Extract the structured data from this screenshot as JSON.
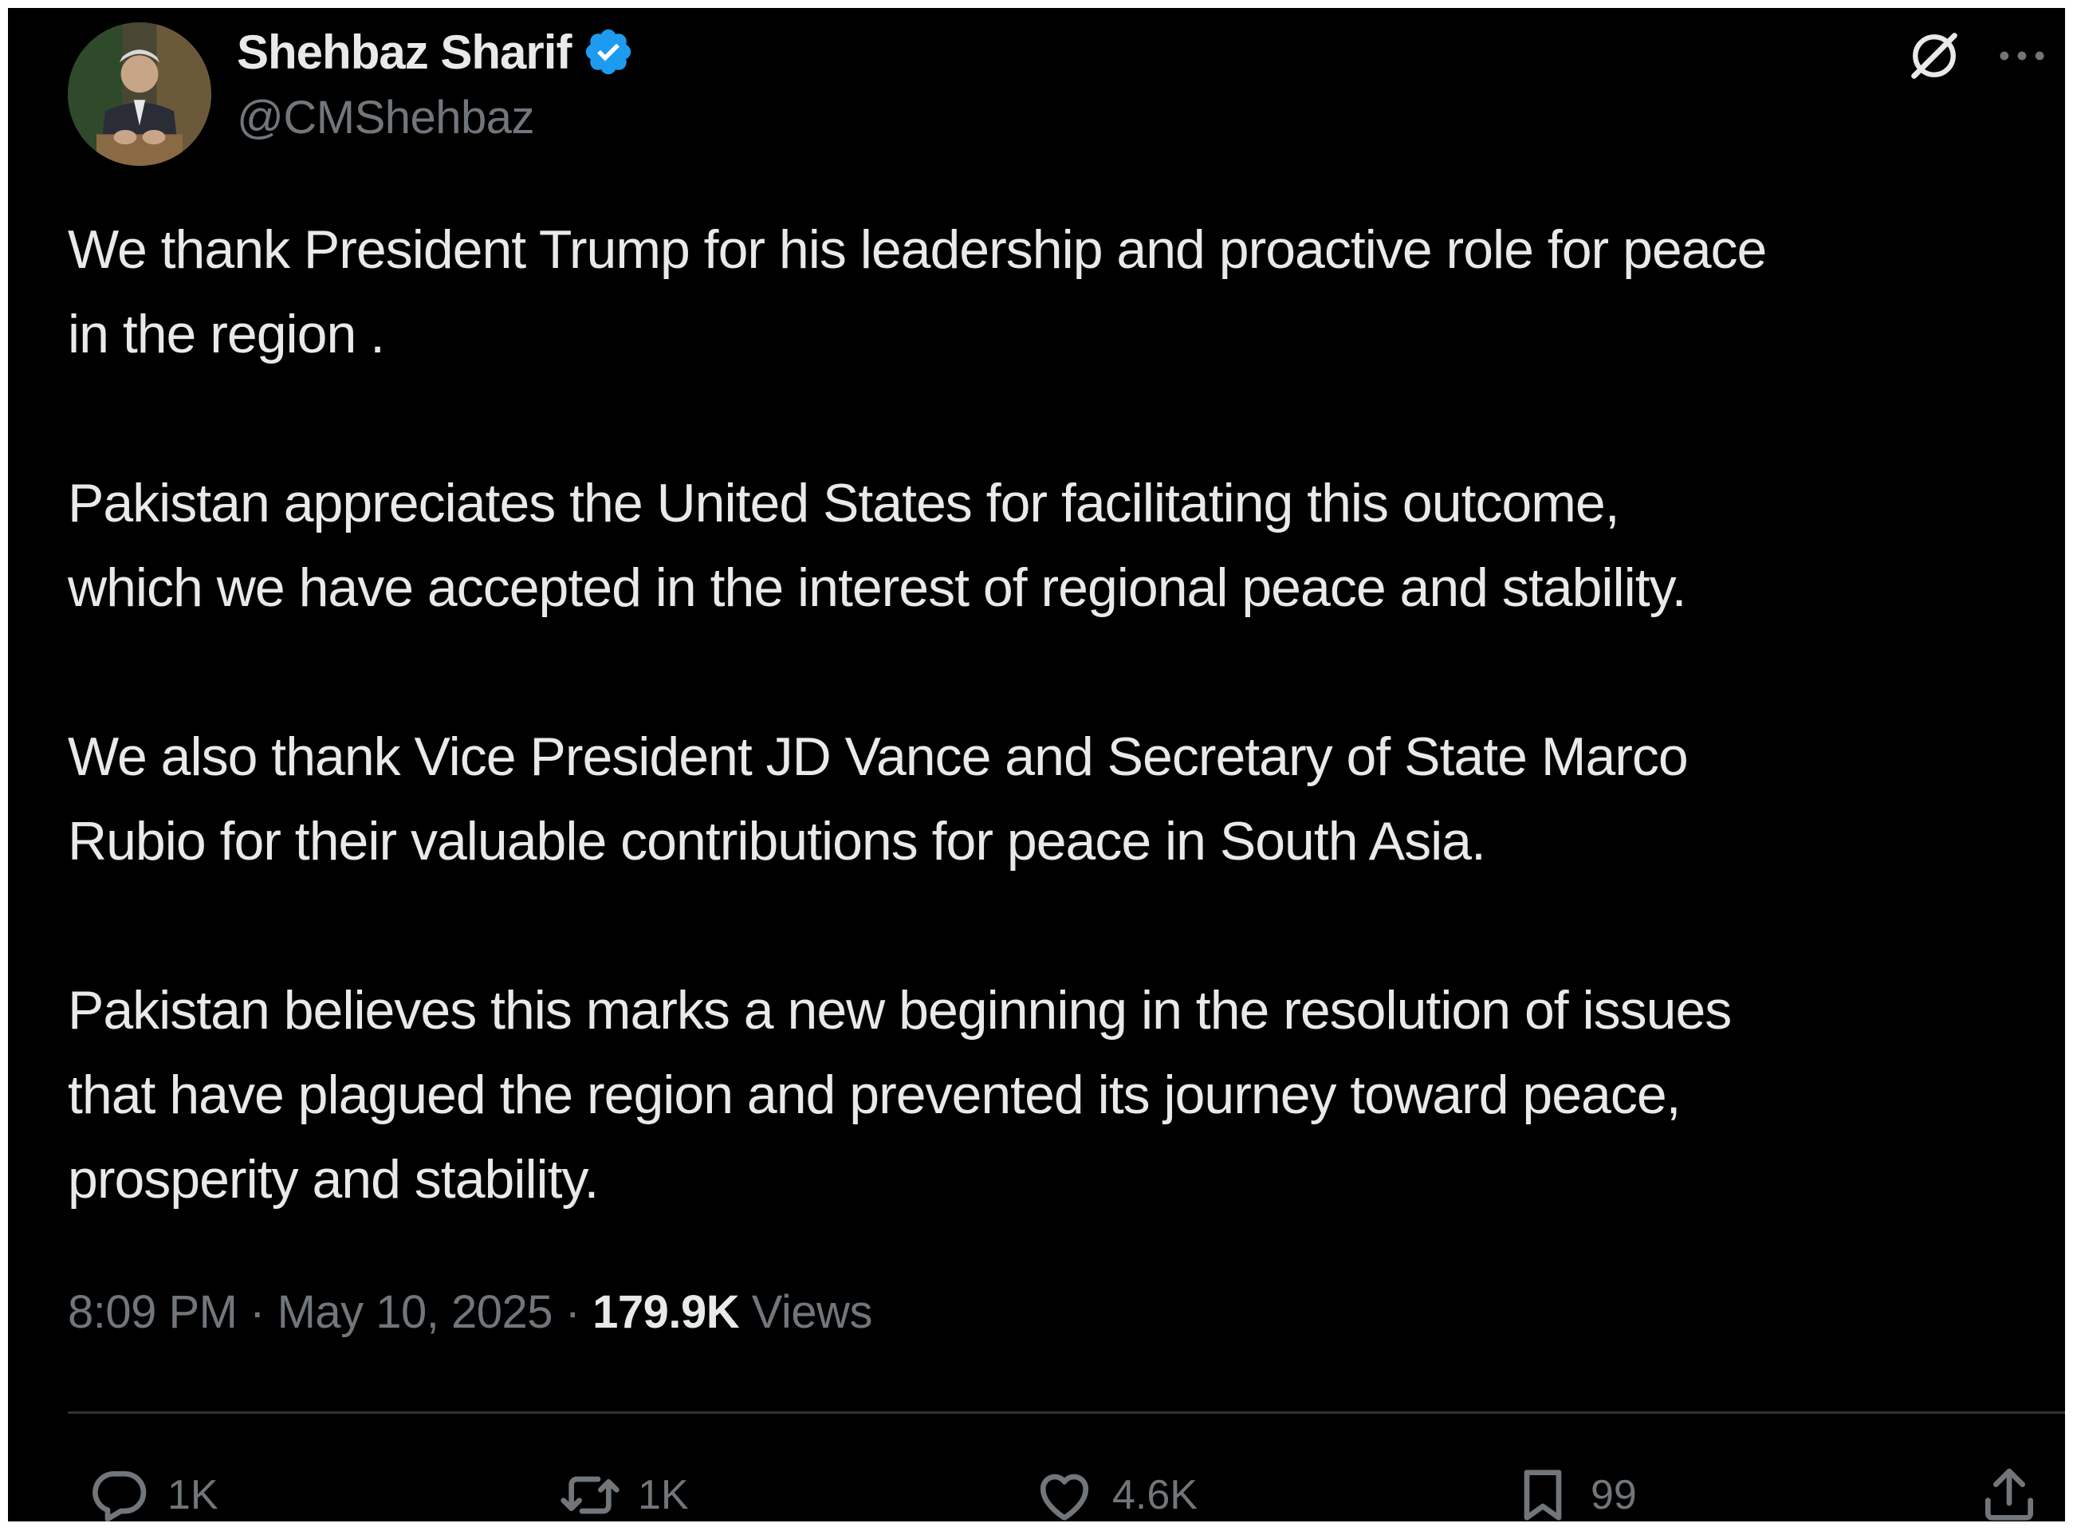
{
  "author": {
    "display_name": "Shehbaz Sharif",
    "handle": "@CMShehbaz",
    "verified": true,
    "verified_color": "#1d9bf0"
  },
  "tweet": {
    "paragraphs": [
      "We thank President Trump for his leadership and proactive role for peace\nin the region .",
      "Pakistan appreciates the United States for facilitating this outcome,\nwhich we have accepted in the interest of regional peace and stability.",
      "We also thank Vice President JD Vance and Secretary of State Marco\nRubio for their valuable contributions for peace in South Asia.",
      "Pakistan believes this marks a new beginning in the resolution of issues\nthat have plagued the region and prevented its journey toward peace,\nprosperity and stability."
    ],
    "time": "8:09 PM",
    "date": "May 10, 2025",
    "separator": "·",
    "views_count": "179.9K",
    "views_label": "Views"
  },
  "actions": {
    "replies": "1K",
    "reposts": "1K",
    "likes": "4.6K",
    "bookmarks": "99"
  },
  "icons": [
    "grok-icon",
    "more-icon",
    "reply-icon",
    "repost-icon",
    "like-icon",
    "bookmark-icon",
    "share-icon",
    "verified-badge-icon"
  ],
  "colors": {
    "background": "#000000",
    "text": "#e7e9ea",
    "muted": "#71767b",
    "divider": "#2f3336"
  }
}
